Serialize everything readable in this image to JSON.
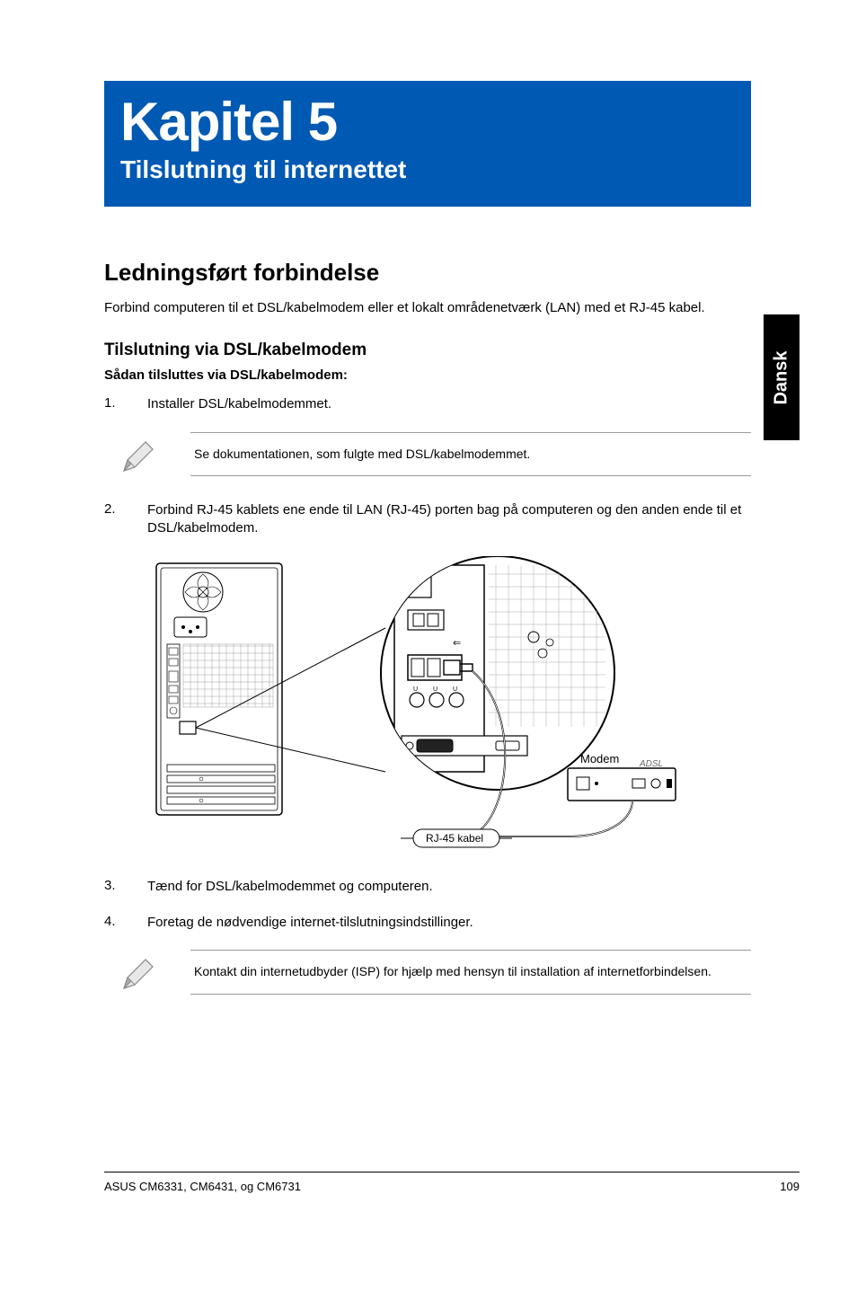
{
  "chapter": {
    "title": "Kapitel 5",
    "subtitle": "Tilslutning til internettet"
  },
  "section": {
    "heading": "Ledningsført forbindelse",
    "intro": "Forbind computeren til et DSL/kabelmodem eller et lokalt områdenetværk (LAN) med et RJ-45 kabel."
  },
  "subsection": {
    "heading": "Tilslutning via DSL/kabelmodem",
    "subheading": "Sådan tilsluttes via DSL/kabelmodem:"
  },
  "steps_a": [
    {
      "num": "1.",
      "text": "Installer DSL/kabelmodemmet."
    }
  ],
  "note1": "Se dokumentationen, som fulgte med DSL/kabelmodemmet.",
  "steps_b": [
    {
      "num": "2.",
      "text": "Forbind RJ-45 kablets ene ende til LAN (RJ-45) porten bag på computeren og den anden ende til et DSL/kabelmodem."
    }
  ],
  "diagram_labels": {
    "modem": "Modem",
    "cable": "RJ-45 kabel",
    "modem_brand": "ADSL"
  },
  "steps_c": [
    {
      "num": "3.",
      "text": "Tænd for DSL/kabelmodemmet og computeren."
    },
    {
      "num": "4.",
      "text": "Foretag de nødvendige internet-tilslutningsindstillinger."
    }
  ],
  "note2": "Kontakt din internetudbyder (ISP) for hjælp med hensyn til installation af internetforbindelsen.",
  "side_tab": "Dansk",
  "footer": {
    "left": "ASUS CM6331, CM6431, og CM6731",
    "right": "109"
  }
}
